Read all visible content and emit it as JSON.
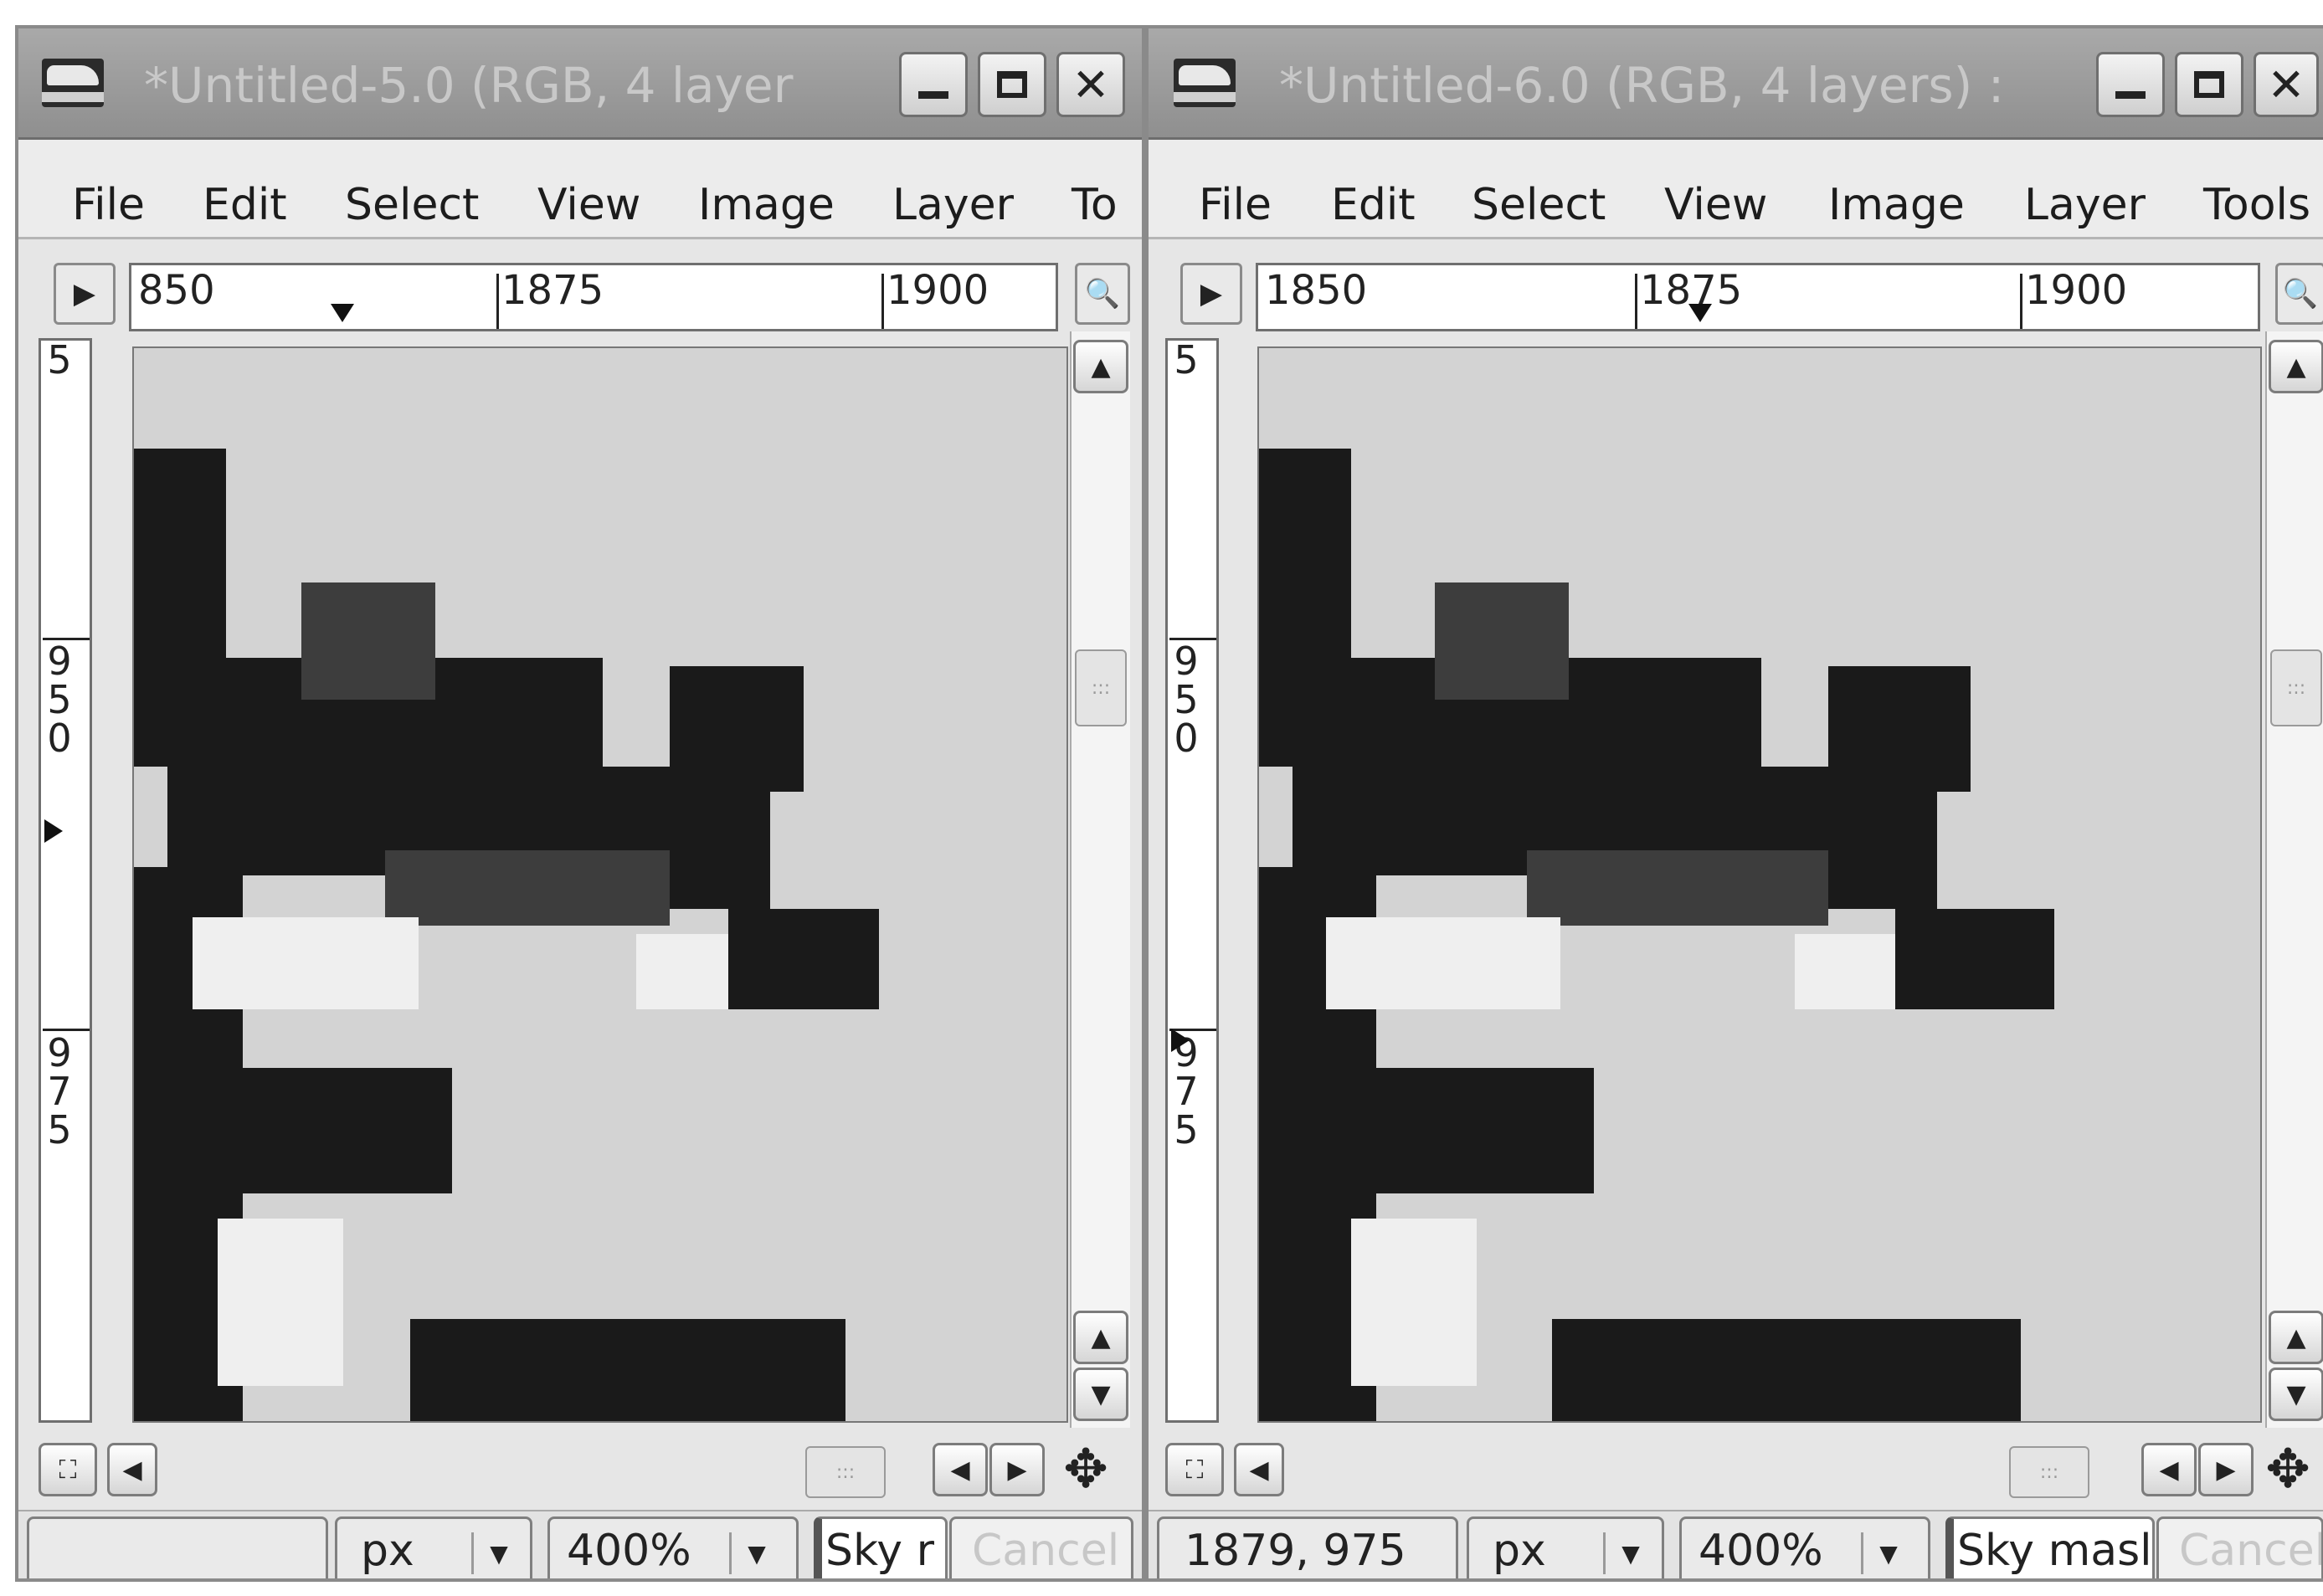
{
  "windows": [
    {
      "title": "*Untitled-5.0 (RGB, 4 layer",
      "menu": [
        "File",
        "Edit",
        "Select",
        "View",
        "Image",
        "Layer",
        "To"
      ],
      "ruler_h": [
        "850",
        "1875",
        "1900"
      ],
      "ruler_v": [
        "9\n5\n0",
        "9\n7\n5",
        "5"
      ],
      "status": {
        "coords": "",
        "unit": "px",
        "zoom": "400%",
        "message": "Sky r",
        "cancel": "Cancel"
      }
    },
    {
      "title": "*Untitled-6.0 (RGB, 4 layers) :",
      "menu": [
        "File",
        "Edit",
        "Select",
        "View",
        "Image",
        "Layer",
        "Tools"
      ],
      "ruler_h": [
        "1850",
        "1875",
        "1900"
      ],
      "ruler_v": [
        "9\n5\n0",
        "9\n7\n5",
        "5"
      ],
      "status": {
        "coords": "1879, 975",
        "unit": "px",
        "zoom": "400%",
        "message": "Sky masl",
        "cancel": "Cancel"
      }
    }
  ],
  "icons": {
    "minimize": "minimize-icon",
    "maximize": "maximize-icon",
    "close": "close-icon",
    "close_glyph": "✕",
    "menu_toggle": "▶",
    "zoom": "🔍",
    "up": "▲",
    "down": "▼",
    "left": "◀",
    "right": "▶",
    "move": "✥",
    "quickmask": "⛶"
  },
  "colors": {
    "titlebar": "#9a9a9a",
    "canvas": "#d3d3d3",
    "dark": "#1a1a1a"
  }
}
